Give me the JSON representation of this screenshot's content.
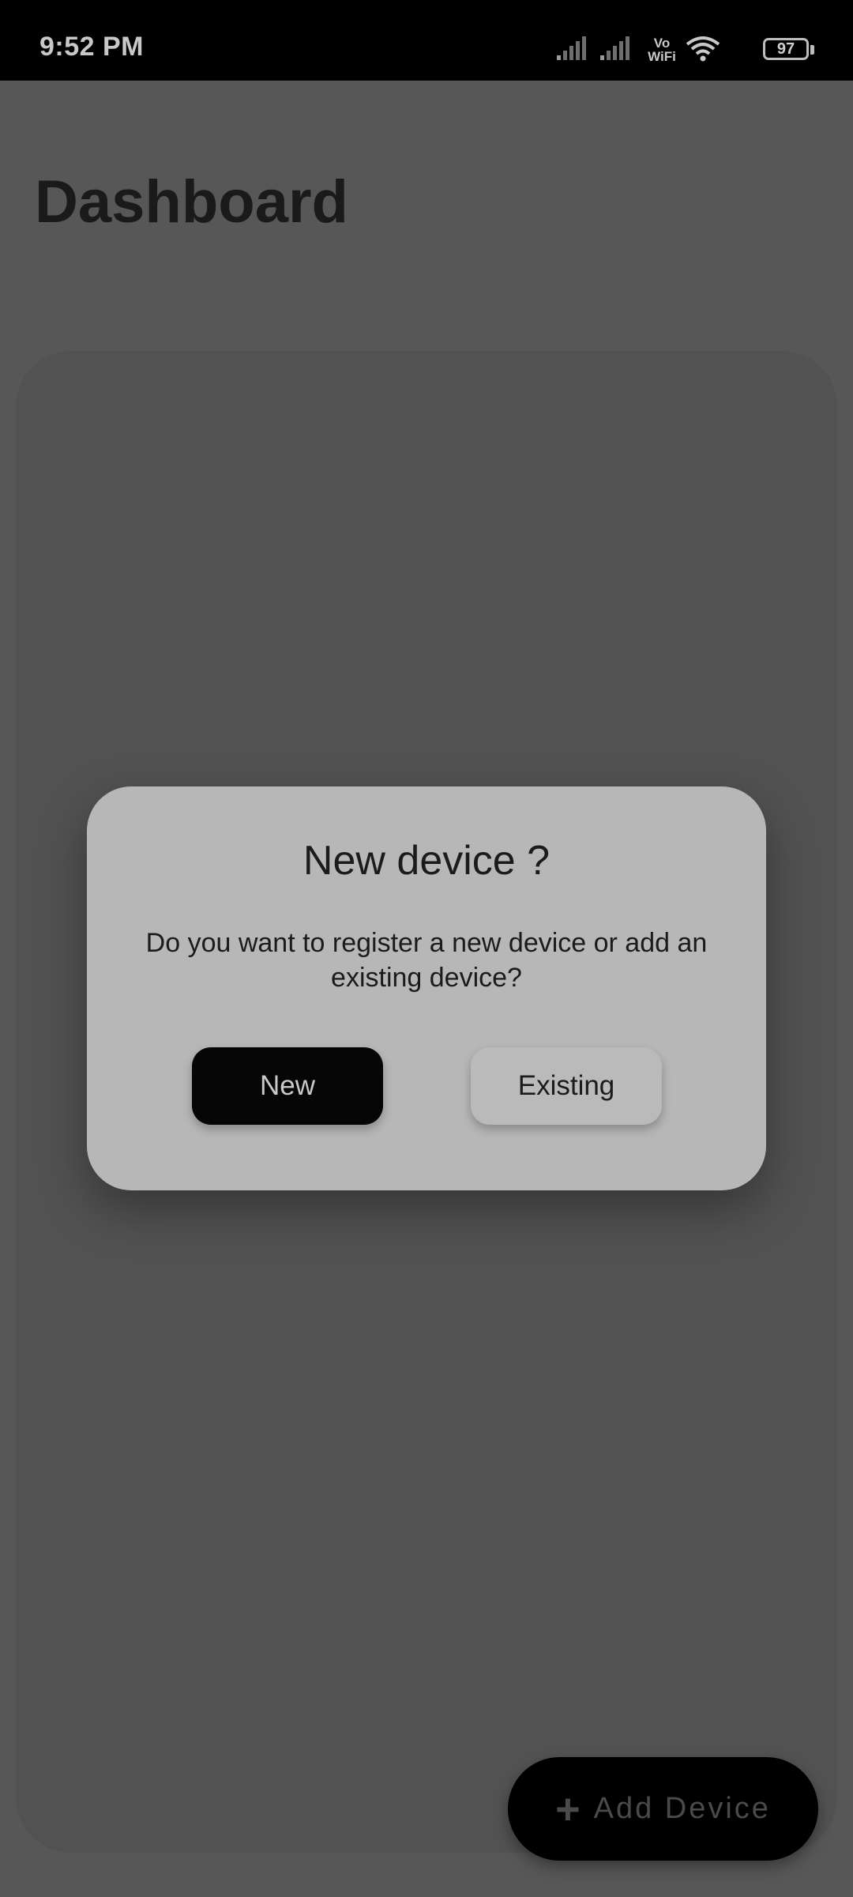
{
  "status_bar": {
    "time": "9:52 PM",
    "network_label_top": "Vo",
    "network_label_bottom": "WiFi",
    "battery_level": "97",
    "icons": [
      "cell-signal-icon",
      "cell-signal-icon",
      "vowifi-icon",
      "wifi-icon",
      "battery-icon"
    ]
  },
  "page": {
    "title": "Dashboard"
  },
  "dialog": {
    "title": "New device ?",
    "message": "Do you want to register a new device or add an existing device?",
    "primary_label": "New",
    "secondary_label": "Existing"
  },
  "fab": {
    "icon": "plus-icon",
    "label": "Add Device"
  },
  "colors": {
    "scrim": "#575757",
    "dialog_bg": "#b7b7b7",
    "primary_button": "#060606",
    "fab": "#000000"
  }
}
